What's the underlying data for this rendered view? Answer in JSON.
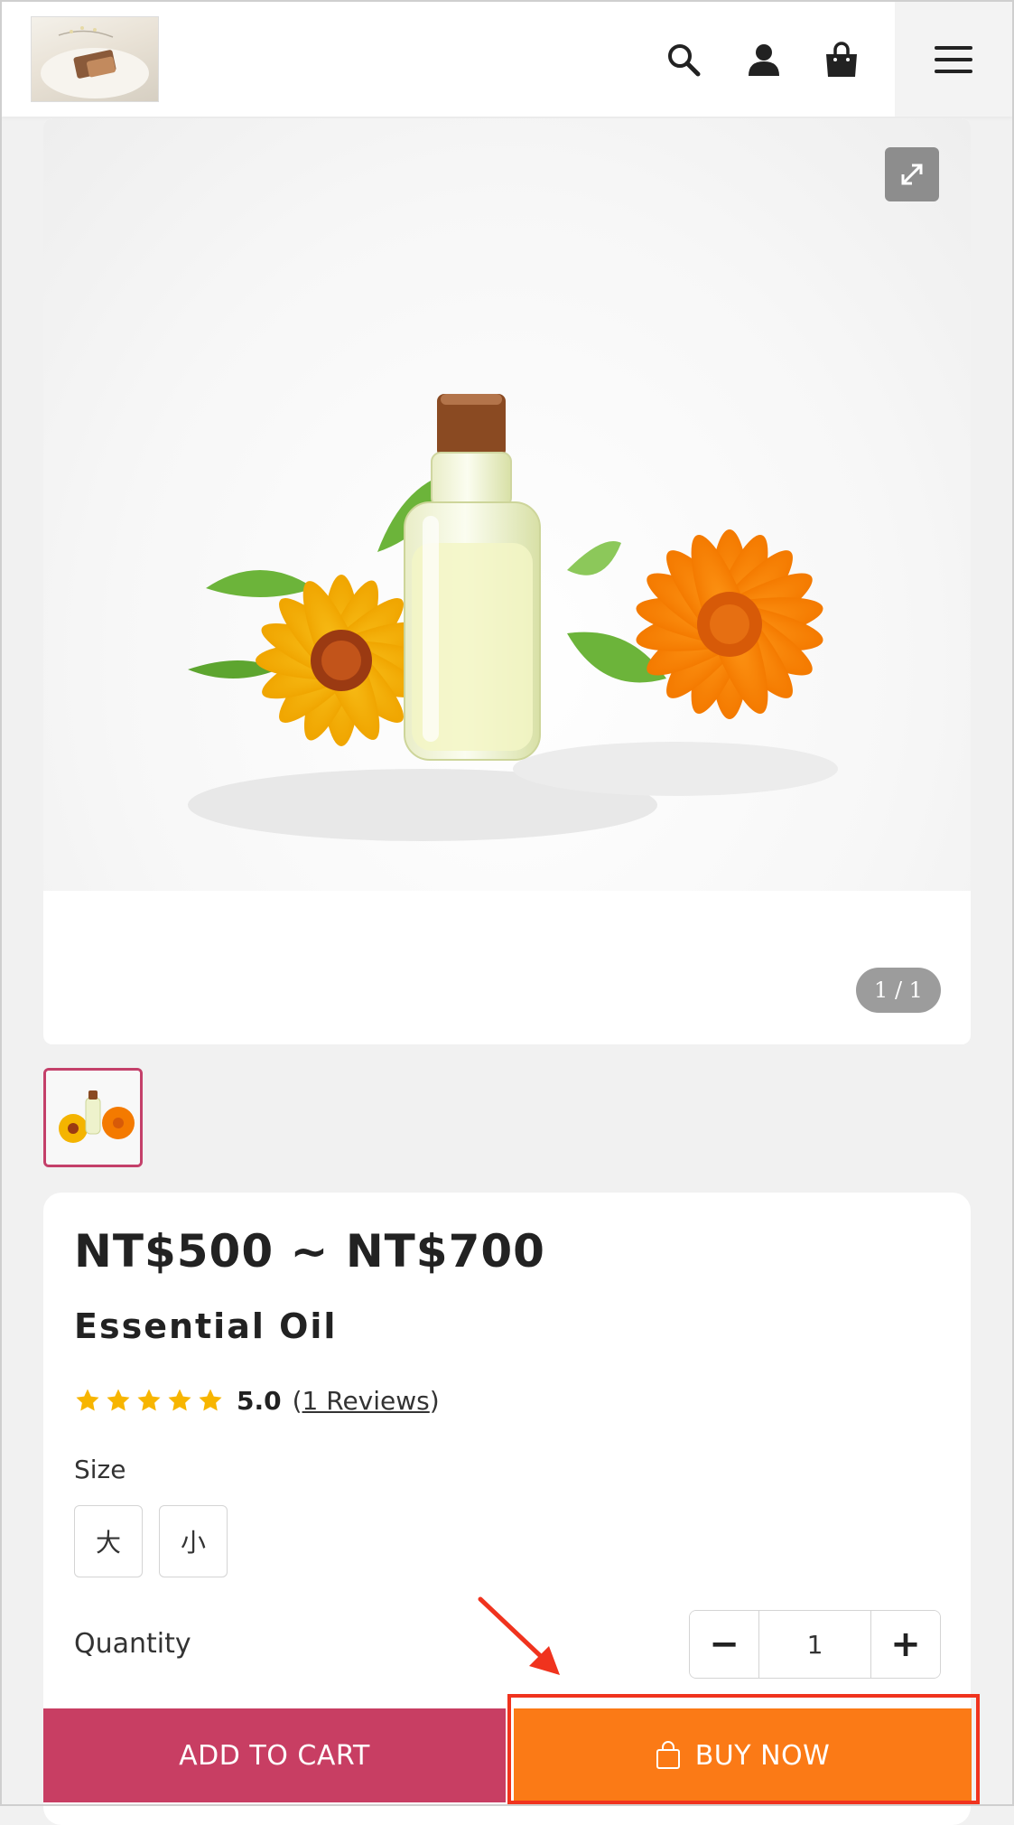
{
  "header": {
    "logo_icon": "shop-logo-image",
    "icons": [
      "search-icon",
      "user-icon",
      "shopping-bag-icon",
      "hamburger-menu-icon"
    ]
  },
  "gallery": {
    "image_icon": "essential-oil-bottle-with-flowers",
    "pager_text": "1 / 1",
    "expand_icon": "expand-arrows-icon"
  },
  "product": {
    "price": "NT$500 ~ NT$700",
    "name": "Essential Oil",
    "rating_value": "5.0",
    "star_count": 5,
    "reviews_prefix": "(",
    "reviews_link": "1 Reviews",
    "reviews_suffix": ")",
    "size_label": "Size",
    "size_options": [
      "大",
      "小"
    ],
    "quantity_label": "Quantity",
    "quantity_value": "1",
    "qty_minus": "−",
    "qty_plus": "+"
  },
  "actions": {
    "add_to_cart": "ADD TO CART",
    "buy_now": "BUY NOW"
  },
  "colors": {
    "add_to_cart_bg": "#c83e63",
    "buy_now_bg": "#fb7a16",
    "star": "#f7b500",
    "highlight": "#f0331e"
  }
}
